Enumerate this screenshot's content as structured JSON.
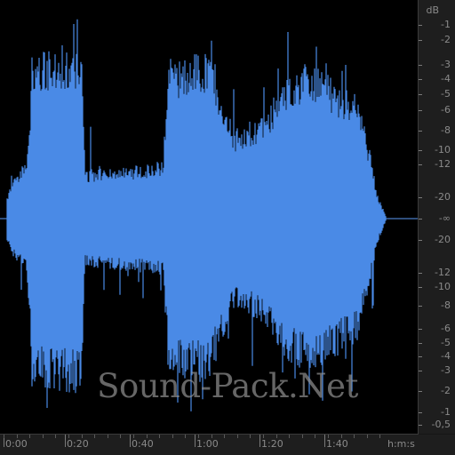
{
  "app": {
    "watermark": "Sound-Pack.Net"
  },
  "colors": {
    "background": "#000000",
    "waveform_fill": "#4a8ae6",
    "waveform_edge": "#5b9cf6",
    "center_line": "#5b9cf6",
    "ruler_bg": "#1e1e1e",
    "ruler_text": "#8a8a8a"
  },
  "db_ruler": {
    "unit": "dB",
    "upper_labels": [
      "-1",
      "-2",
      "-3",
      "-4",
      "-5",
      "-6",
      "-8",
      "-10",
      "-12",
      "-20"
    ],
    "center_label": "-∞",
    "lower_labels": [
      "-20",
      "-12",
      "-10",
      "-8",
      "-6",
      "-5",
      "-4",
      "-3",
      "-2",
      "-1",
      "-0,5"
    ]
  },
  "time_ruler": {
    "unit": "h:m:s",
    "labels": [
      "0:00",
      "0:20",
      "0:40",
      "1:00",
      "1:20",
      "1:40"
    ]
  },
  "waveform": {
    "duration_s": 118,
    "envelope": [
      {
        "t": 0,
        "amp": 0.1
      },
      {
        "t": 2,
        "amp": 0.18
      },
      {
        "t": 6,
        "amp": 0.25
      },
      {
        "t": 8,
        "amp": 0.75
      },
      {
        "t": 20,
        "amp": 0.8
      },
      {
        "t": 23,
        "amp": 0.78
      },
      {
        "t": 24,
        "amp": 0.22
      },
      {
        "t": 40,
        "amp": 0.24
      },
      {
        "t": 48,
        "amp": 0.26
      },
      {
        "t": 50,
        "amp": 0.72
      },
      {
        "t": 62,
        "amp": 0.75
      },
      {
        "t": 70,
        "amp": 0.4
      },
      {
        "t": 80,
        "amp": 0.48
      },
      {
        "t": 85,
        "amp": 0.65
      },
      {
        "t": 95,
        "amp": 0.7
      },
      {
        "t": 108,
        "amp": 0.55
      },
      {
        "t": 112,
        "amp": 0.3
      },
      {
        "t": 114,
        "amp": 0.12
      },
      {
        "t": 117,
        "amp": 0.0
      },
      {
        "t": 118,
        "amp": 0.0
      }
    ]
  }
}
